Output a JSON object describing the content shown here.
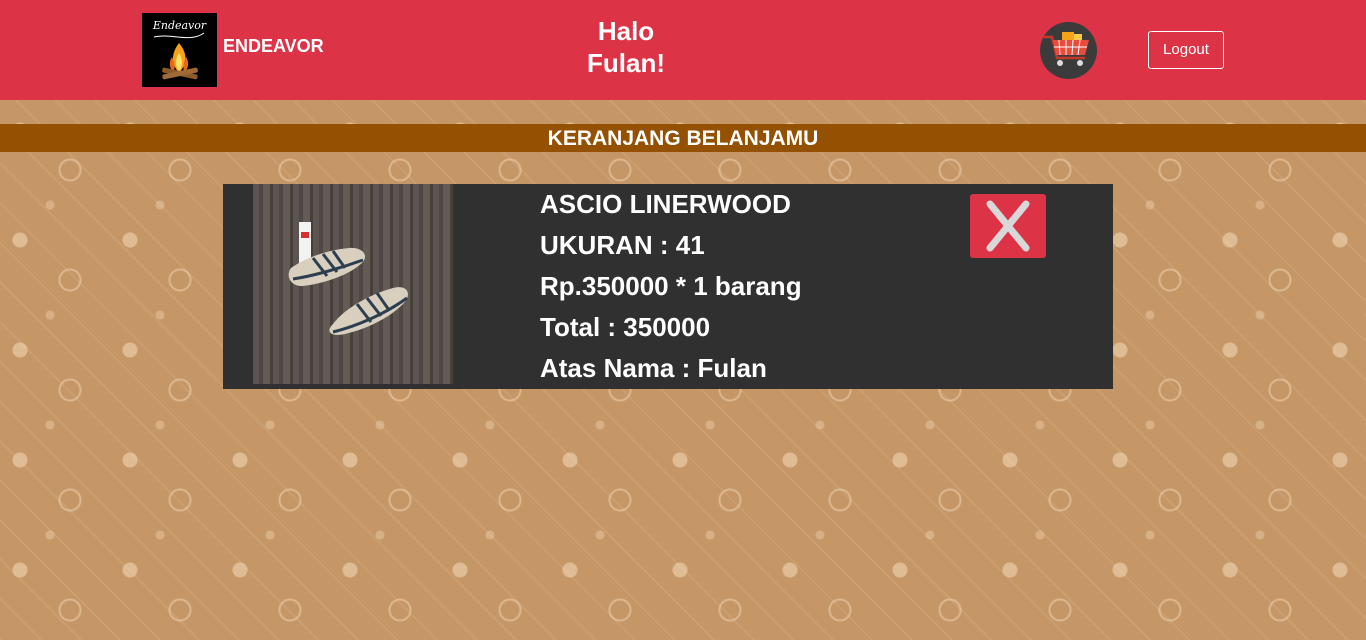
{
  "header": {
    "brand": "ENDEAVOR",
    "logo_script": "Endeavor",
    "greeting_line1": "Halo",
    "greeting_line2": "Fulan!",
    "logout_label": "Logout",
    "cart_icon": "shopping-cart-icon",
    "background_color": "#dc3446"
  },
  "section": {
    "title": "KERANJANG BELANJAMU",
    "background_color": "#945102"
  },
  "cart_item": {
    "name": "ASCIO LINERWOOD",
    "size_line": "UKURAN : 41",
    "price_line": "Rp.350000 * 1 barang",
    "total_line": "Total : 350000",
    "owner_line": "Atas Nama : Fulan",
    "remove_icon": "close-icon",
    "remove_color": "#dc3446",
    "card_color": "#303030"
  },
  "page": {
    "background_color": "#c59666"
  }
}
